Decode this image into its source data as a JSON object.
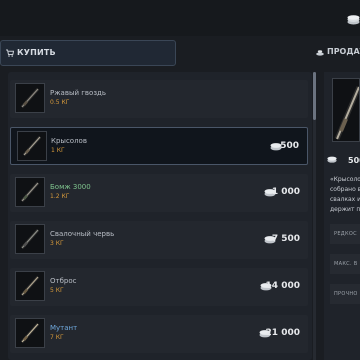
{
  "tabs": {
    "buy_label": "КУПИТЬ",
    "sell_label": "ПРОДАТЬ"
  },
  "items": [
    {
      "name": "Ржавый гвоздь",
      "weight": "0.5 КГ",
      "price": ""
    },
    {
      "name": "Крысолов",
      "weight": "1 КГ",
      "price": "500"
    },
    {
      "name": "Бомж 3000",
      "weight": "1.2 КГ",
      "price": "1 000"
    },
    {
      "name": "Свалочный червь",
      "weight": "3 КГ",
      "price": "7 500"
    },
    {
      "name": "Отброс",
      "weight": "5 КГ",
      "price": "14 000"
    },
    {
      "name": "Мутант",
      "weight": "7 КГ",
      "price": "21 000"
    }
  ],
  "detail": {
    "price": "500",
    "description_lines": [
      "«Крысолов",
      "собрано в",
      "свалках и",
      "держит п"
    ],
    "stats": [
      "РЕДКОС",
      "МАКС. В",
      "ПРОЧНО"
    ]
  },
  "colors": {
    "weight": "#d4983b",
    "name_default": "#b9bec6",
    "name_uncommon": "#7ec38d",
    "name_rare": "#6fa8dc",
    "selected_border": "#4a5668"
  },
  "icons": {
    "currency": "coin-stack-icon",
    "buy": "cart-icon",
    "sell": "sell-icon",
    "item": "fishing-rod-icon"
  }
}
